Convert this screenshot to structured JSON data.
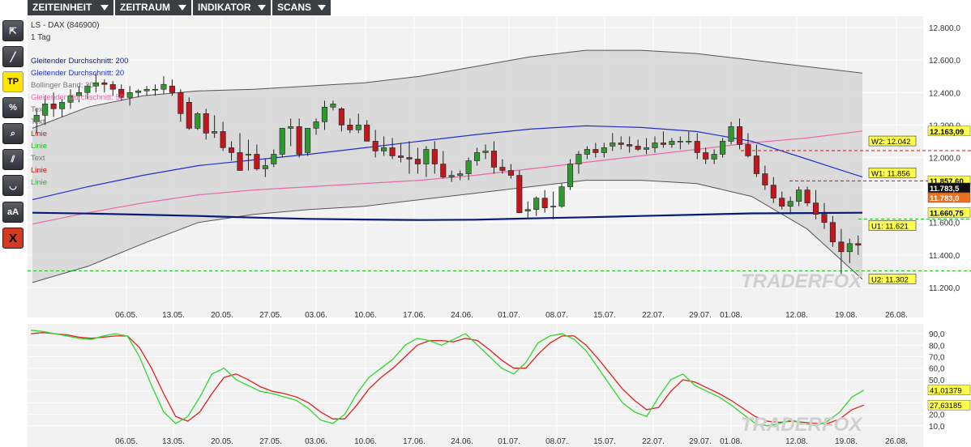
{
  "menu": [
    {
      "label": "ZEITEINHEIT"
    },
    {
      "label": "ZEITRAUM"
    },
    {
      "label": "INDIKATOR"
    },
    {
      "label": "SCANS"
    }
  ],
  "tools": [
    {
      "name": "cursor-tool-icon",
      "label": "⇱"
    },
    {
      "name": "trendline-tool-icon",
      "label": "╱"
    },
    {
      "name": "tp-tool-button",
      "label": "TP"
    },
    {
      "name": "percent-tool-button",
      "label": "%"
    },
    {
      "name": "zoom-tool-icon",
      "label": "⌕"
    },
    {
      "name": "channel-tool-icon",
      "label": "⫽"
    },
    {
      "name": "arc-tool-icon",
      "label": "◡"
    },
    {
      "name": "text-tool-button",
      "label": "aA"
    },
    {
      "name": "delete-tool-button",
      "label": "X"
    }
  ],
  "colors": {
    "up": "#2e9a2e",
    "down": "#c0161c",
    "sma200": "#0a1a7a",
    "sma20": "#2030d0",
    "sma50": "#e86aa8",
    "band": "#d6d6d6",
    "stoch_k": "#2fd72f",
    "stoch_d": "#e02020"
  },
  "chart_data": [
    {
      "type": "candlestick",
      "title": "LS - DAX (846900)",
      "subtitle": "1 Tag",
      "legend": [
        {
          "label": "Gleitender Durchschnitt: 200",
          "color": "#0a1a7a"
        },
        {
          "label": "Gleitender Durchschnitt: 20",
          "color": "#2030d0"
        },
        {
          "label": "Bollinger Band: 20",
          "color": "#777777"
        },
        {
          "label": "Gleitender Durchschnitt: 50",
          "color": "#e86aa8"
        },
        {
          "label": "Text",
          "color": "#777777"
        },
        {
          "label": "Text",
          "color": "#777777"
        },
        {
          "label": "Linie",
          "color": "#d01010"
        },
        {
          "label": "Linie",
          "color": "#20c020"
        },
        {
          "label": "Text",
          "color": "#777777"
        },
        {
          "label": "Linie",
          "color": "#d01010"
        },
        {
          "label": "Linie",
          "color": "#20c020"
        }
      ],
      "x_ticks": [
        "06.05.",
        "13.05.",
        "20.05.",
        "27.05.",
        "03.06.",
        "10.06.",
        "17.06.",
        "24.06.",
        "01.07.",
        "08.07.",
        "15.07.",
        "22.07.",
        "29.07.",
        "01.08.",
        "12.08.",
        "19.08.",
        "26.08."
      ],
      "y_ticks": [
        "12.800,0",
        "12.600,0",
        "12.400,0",
        "12.200,0",
        "12.000,0",
        "11.800,0",
        "11.600,0",
        "11.400,0",
        "11.200,0"
      ],
      "ylim": [
        11100,
        12850
      ],
      "candles": [
        [
          12220,
          12300,
          12150,
          12260
        ],
        [
          12260,
          12380,
          12200,
          12330
        ],
        [
          12330,
          12400,
          12250,
          12300
        ],
        [
          12300,
          12360,
          12250,
          12340
        ],
        [
          12340,
          12420,
          12300,
          12380
        ],
        [
          12380,
          12440,
          12340,
          12400
        ],
        [
          12400,
          12450,
          12360,
          12440
        ],
        [
          12440,
          12520,
          12400,
          12460
        ],
        [
          12460,
          12480,
          12400,
          12450
        ],
        [
          12450,
          12470,
          12380,
          12420
        ],
        [
          12420,
          12450,
          12350,
          12370
        ],
        [
          12370,
          12440,
          12320,
          12400
        ],
        [
          12400,
          12420,
          12370,
          12410
        ],
        [
          12410,
          12440,
          12380,
          12420
        ],
        [
          12420,
          12450,
          12380,
          12420
        ],
        [
          12420,
          12500,
          12390,
          12450
        ],
        [
          12440,
          12480,
          12380,
          12400
        ],
        [
          12400,
          12420,
          12220,
          12270
        ],
        [
          12340,
          12370,
          12170,
          12180
        ],
        [
          12180,
          12280,
          12170,
          12270
        ],
        [
          12270,
          12300,
          12110,
          12150
        ],
        [
          12150,
          12260,
          12120,
          12160
        ],
        [
          12160,
          12220,
          12040,
          12060
        ],
        [
          12060,
          12100,
          11980,
          12030
        ],
        [
          12030,
          12150,
          11970,
          11920
        ],
        [
          12020,
          12110,
          11920,
          12020
        ],
        [
          12020,
          12080,
          11920,
          11930
        ],
        [
          11930,
          11990,
          11880,
          11950
        ],
        [
          11960,
          12050,
          11940,
          12020
        ],
        [
          12020,
          12180,
          12000,
          12180
        ],
        [
          12180,
          12240,
          12070,
          12190
        ],
        [
          12190,
          12240,
          12000,
          12020
        ],
        [
          12030,
          12180,
          12010,
          12180
        ],
        [
          12180,
          12240,
          12140,
          12220
        ],
        [
          12220,
          12350,
          12170,
          12310
        ],
        [
          12310,
          12350,
          12290,
          12330
        ],
        [
          12300,
          12310,
          12160,
          12200
        ],
        [
          12200,
          12240,
          12150,
          12170
        ],
        [
          12170,
          12270,
          12150,
          12200
        ],
        [
          12200,
          12230,
          12100,
          12100
        ],
        [
          12100,
          12170,
          12000,
          12040
        ],
        [
          12040,
          12130,
          12010,
          12060
        ],
        [
          12060,
          12120,
          11990,
          12010
        ],
        [
          12010,
          12090,
          11970,
          12000
        ],
        [
          12000,
          12100,
          11900,
          11990
        ],
        [
          11990,
          12060,
          11900,
          11960
        ],
        [
          11960,
          12070,
          11880,
          12050
        ],
        [
          12050,
          12100,
          11900,
          11960
        ],
        [
          11960,
          12040,
          11870,
          11880
        ],
        [
          11880,
          11920,
          11850,
          11890
        ],
        [
          11890,
          11920,
          11860,
          11900
        ],
        [
          11900,
          12000,
          11860,
          11980
        ],
        [
          11980,
          12060,
          11950,
          12030
        ],
        [
          12030,
          12080,
          11990,
          12040
        ],
        [
          12040,
          12100,
          11900,
          11940
        ],
        [
          11940,
          11990,
          11900,
          11920
        ],
        [
          11920,
          11960,
          11870,
          11890
        ],
        [
          11890,
          11920,
          11700,
          11660
        ],
        [
          11670,
          11730,
          11620,
          11680
        ],
        [
          11680,
          11760,
          11640,
          11750
        ],
        [
          11750,
          11800,
          11660,
          11690
        ],
        [
          11700,
          11790,
          11620,
          11700
        ],
        [
          11700,
          11840,
          11690,
          11820
        ],
        [
          11820,
          11990,
          11800,
          11960
        ],
        [
          11960,
          12040,
          11900,
          12020
        ],
        [
          12020,
          12070,
          11990,
          12050
        ],
        [
          12050,
          12090,
          12000,
          12030
        ],
        [
          12030,
          12090,
          12000,
          12060
        ],
        [
          12070,
          12150,
          12040,
          12090
        ],
        [
          12090,
          12130,
          12050,
          12080
        ],
        [
          12080,
          12130,
          12030,
          12070
        ],
        [
          12070,
          12110,
          12040,
          12050
        ],
        [
          12050,
          12120,
          12020,
          12060
        ],
        [
          12060,
          12130,
          12030,
          12090
        ],
        [
          12090,
          12160,
          12060,
          12080
        ],
        [
          12080,
          12120,
          12060,
          12100
        ],
        [
          12100,
          12130,
          12050,
          12100
        ],
        [
          12100,
          12160,
          12080,
          12100
        ],
        [
          12100,
          12150,
          11990,
          12030
        ],
        [
          12030,
          12060,
          11960,
          11990
        ],
        [
          11990,
          12050,
          11960,
          12020
        ],
        [
          12020,
          12120,
          12000,
          12100
        ],
        [
          12100,
          12220,
          12080,
          12190
        ],
        [
          12190,
          12240,
          12050,
          12080
        ],
        [
          12080,
          12150,
          12000,
          12010
        ],
        [
          12010,
          12080,
          11880,
          11900
        ],
        [
          11900,
          11950,
          11800,
          11830
        ],
        [
          11830,
          11880,
          11720,
          11750
        ],
        [
          11750,
          11790,
          11680,
          11700
        ],
        [
          11700,
          11760,
          11650,
          11730
        ],
        [
          11730,
          11820,
          11700,
          11800
        ],
        [
          11800,
          11820,
          11700,
          11720
        ],
        [
          11720,
          11800,
          11620,
          11650
        ],
        [
          11650,
          11720,
          11560,
          11600
        ],
        [
          11600,
          11640,
          11450,
          11480
        ],
        [
          11480,
          11560,
          11280,
          11420
        ],
        [
          11420,
          11500,
          11350,
          11470
        ],
        [
          11470,
          11520,
          11400,
          11460
        ]
      ],
      "sma200_points": [
        [
          0,
          11660
        ],
        [
          10,
          11655
        ],
        [
          20,
          11648
        ],
        [
          30,
          11640
        ],
        [
          40,
          11630
        ],
        [
          50,
          11622
        ],
        [
          60,
          11618
        ],
        [
          70,
          11615
        ],
        [
          80,
          11617
        ],
        [
          90,
          11625
        ],
        [
          100,
          11632
        ],
        [
          110,
          11640
        ],
        [
          120,
          11648
        ],
        [
          130,
          11656
        ],
        [
          140,
          11658
        ],
        [
          150,
          11660
        ]
      ],
      "sma20_points": [
        [
          0,
          11740
        ],
        [
          10,
          11820
        ],
        [
          20,
          11890
        ],
        [
          30,
          11950
        ],
        [
          40,
          11985
        ],
        [
          50,
          12020
        ],
        [
          60,
          12060
        ],
        [
          70,
          12100
        ],
        [
          80,
          12140
        ],
        [
          90,
          12175
        ],
        [
          100,
          12195
        ],
        [
          110,
          12185
        ],
        [
          120,
          12160
        ],
        [
          130,
          12100
        ],
        [
          140,
          11990
        ],
        [
          150,
          11880
        ]
      ],
      "sma50_points": [
        [
          0,
          11590
        ],
        [
          10,
          11660
        ],
        [
          20,
          11720
        ],
        [
          30,
          11770
        ],
        [
          40,
          11800
        ],
        [
          50,
          11820
        ],
        [
          60,
          11840
        ],
        [
          70,
          11860
        ],
        [
          80,
          11890
        ],
        [
          90,
          11930
        ],
        [
          100,
          11970
        ],
        [
          110,
          12010
        ],
        [
          120,
          12050
        ],
        [
          130,
          12090
        ],
        [
          140,
          12120
        ],
        [
          150,
          12163
        ]
      ],
      "bb_upper": [
        [
          0,
          12180
        ],
        [
          10,
          12310
        ],
        [
          20,
          12380
        ],
        [
          30,
          12410
        ],
        [
          40,
          12420
        ],
        [
          50,
          12440
        ],
        [
          60,
          12460
        ],
        [
          70,
          12500
        ],
        [
          80,
          12560
        ],
        [
          90,
          12620
        ],
        [
          100,
          12660
        ],
        [
          110,
          12660
        ],
        [
          120,
          12640
        ],
        [
          130,
          12600
        ],
        [
          140,
          12560
        ],
        [
          150,
          12520
        ]
      ],
      "bb_lower": [
        [
          0,
          11230
        ],
        [
          10,
          11330
        ],
        [
          20,
          11470
        ],
        [
          30,
          11600
        ],
        [
          40,
          11650
        ],
        [
          50,
          11680
        ],
        [
          60,
          11700
        ],
        [
          70,
          11740
        ],
        [
          80,
          11780
        ],
        [
          90,
          11820
        ],
        [
          100,
          11860
        ],
        [
          110,
          11860
        ],
        [
          120,
          11840
        ],
        [
          130,
          11760
        ],
        [
          140,
          11560
        ],
        [
          150,
          11250
        ]
      ],
      "last_price_labels": [
        "12.163,09",
        "11.857,60",
        "11.783,5",
        "11.783,0",
        "11.660,75"
      ],
      "level_labels": {
        "W2": {
          "label": "W2: 12.042",
          "value": 12042
        },
        "W1": {
          "label": "W1: 11.856",
          "value": 11856
        },
        "U1": {
          "label": "U1: 11.621",
          "value": 11621
        },
        "U2": {
          "label": "U2: 11.302",
          "value": 11302
        }
      },
      "watermark": "TRADERFOX"
    },
    {
      "type": "line",
      "y_ticks": [
        "90,0",
        "80,0",
        "70,0",
        "60,0",
        "50,0",
        "40,0",
        "30,0",
        "20,0",
        "10,0"
      ],
      "ylim": [
        0,
        95
      ],
      "series": [
        {
          "values": [
            93,
            92,
            90,
            88,
            86,
            85,
            88,
            90,
            88,
            70,
            45,
            22,
            12,
            18,
            35,
            55,
            60,
            50,
            45,
            40,
            38,
            35,
            32,
            25,
            15,
            12,
            20,
            38,
            52,
            60,
            68,
            80,
            86,
            84,
            80,
            85,
            90,
            80,
            70,
            60,
            55,
            65,
            82,
            88,
            90,
            85,
            75,
            60,
            45,
            30,
            22,
            18,
            35,
            50,
            55,
            45,
            40,
            35,
            28,
            20,
            12,
            10,
            12,
            15,
            12,
            10,
            14,
            22,
            35,
            41
          ]
        },
        {
          "values": [
            90,
            91,
            90,
            89,
            87,
            86,
            87,
            88,
            88,
            78,
            60,
            38,
            18,
            14,
            22,
            38,
            52,
            55,
            50,
            44,
            40,
            38,
            35,
            30,
            22,
            16,
            16,
            28,
            42,
            52,
            60,
            70,
            80,
            84,
            84,
            83,
            86,
            84,
            76,
            67,
            60,
            60,
            72,
            82,
            88,
            88,
            80,
            68,
            55,
            42,
            32,
            24,
            26,
            40,
            50,
            48,
            43,
            38,
            32,
            25,
            18,
            14,
            13,
            14,
            13,
            12,
            12,
            16,
            24,
            28
          ]
        }
      ],
      "last_labels": [
        "41,01379",
        "27,63185"
      ],
      "watermark": "TRADERFOX"
    }
  ]
}
